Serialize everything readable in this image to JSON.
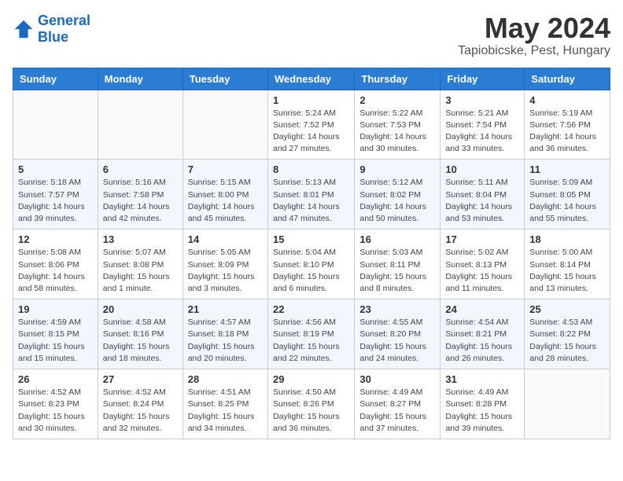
{
  "header": {
    "logo_line1": "General",
    "logo_line2": "Blue",
    "month": "May 2024",
    "location": "Tapiobicske, Pest, Hungary"
  },
  "weekdays": [
    "Sunday",
    "Monday",
    "Tuesday",
    "Wednesday",
    "Thursday",
    "Friday",
    "Saturday"
  ],
  "weeks": [
    [
      {
        "day": "",
        "info": ""
      },
      {
        "day": "",
        "info": ""
      },
      {
        "day": "",
        "info": ""
      },
      {
        "day": "1",
        "info": "Sunrise: 5:24 AM\nSunset: 7:52 PM\nDaylight: 14 hours\nand 27 minutes."
      },
      {
        "day": "2",
        "info": "Sunrise: 5:22 AM\nSunset: 7:53 PM\nDaylight: 14 hours\nand 30 minutes."
      },
      {
        "day": "3",
        "info": "Sunrise: 5:21 AM\nSunset: 7:54 PM\nDaylight: 14 hours\nand 33 minutes."
      },
      {
        "day": "4",
        "info": "Sunrise: 5:19 AM\nSunset: 7:56 PM\nDaylight: 14 hours\nand 36 minutes."
      }
    ],
    [
      {
        "day": "5",
        "info": "Sunrise: 5:18 AM\nSunset: 7:57 PM\nDaylight: 14 hours\nand 39 minutes."
      },
      {
        "day": "6",
        "info": "Sunrise: 5:16 AM\nSunset: 7:58 PM\nDaylight: 14 hours\nand 42 minutes."
      },
      {
        "day": "7",
        "info": "Sunrise: 5:15 AM\nSunset: 8:00 PM\nDaylight: 14 hours\nand 45 minutes."
      },
      {
        "day": "8",
        "info": "Sunrise: 5:13 AM\nSunset: 8:01 PM\nDaylight: 14 hours\nand 47 minutes."
      },
      {
        "day": "9",
        "info": "Sunrise: 5:12 AM\nSunset: 8:02 PM\nDaylight: 14 hours\nand 50 minutes."
      },
      {
        "day": "10",
        "info": "Sunrise: 5:11 AM\nSunset: 8:04 PM\nDaylight: 14 hours\nand 53 minutes."
      },
      {
        "day": "11",
        "info": "Sunrise: 5:09 AM\nSunset: 8:05 PM\nDaylight: 14 hours\nand 55 minutes."
      }
    ],
    [
      {
        "day": "12",
        "info": "Sunrise: 5:08 AM\nSunset: 8:06 PM\nDaylight: 14 hours\nand 58 minutes."
      },
      {
        "day": "13",
        "info": "Sunrise: 5:07 AM\nSunset: 8:08 PM\nDaylight: 15 hours\nand 1 minute."
      },
      {
        "day": "14",
        "info": "Sunrise: 5:05 AM\nSunset: 8:09 PM\nDaylight: 15 hours\nand 3 minutes."
      },
      {
        "day": "15",
        "info": "Sunrise: 5:04 AM\nSunset: 8:10 PM\nDaylight: 15 hours\nand 6 minutes."
      },
      {
        "day": "16",
        "info": "Sunrise: 5:03 AM\nSunset: 8:11 PM\nDaylight: 15 hours\nand 8 minutes."
      },
      {
        "day": "17",
        "info": "Sunrise: 5:02 AM\nSunset: 8:13 PM\nDaylight: 15 hours\nand 11 minutes."
      },
      {
        "day": "18",
        "info": "Sunrise: 5:00 AM\nSunset: 8:14 PM\nDaylight: 15 hours\nand 13 minutes."
      }
    ],
    [
      {
        "day": "19",
        "info": "Sunrise: 4:59 AM\nSunset: 8:15 PM\nDaylight: 15 hours\nand 15 minutes."
      },
      {
        "day": "20",
        "info": "Sunrise: 4:58 AM\nSunset: 8:16 PM\nDaylight: 15 hours\nand 18 minutes."
      },
      {
        "day": "21",
        "info": "Sunrise: 4:57 AM\nSunset: 8:18 PM\nDaylight: 15 hours\nand 20 minutes."
      },
      {
        "day": "22",
        "info": "Sunrise: 4:56 AM\nSunset: 8:19 PM\nDaylight: 15 hours\nand 22 minutes."
      },
      {
        "day": "23",
        "info": "Sunrise: 4:55 AM\nSunset: 8:20 PM\nDaylight: 15 hours\nand 24 minutes."
      },
      {
        "day": "24",
        "info": "Sunrise: 4:54 AM\nSunset: 8:21 PM\nDaylight: 15 hours\nand 26 minutes."
      },
      {
        "day": "25",
        "info": "Sunrise: 4:53 AM\nSunset: 8:22 PM\nDaylight: 15 hours\nand 28 minutes."
      }
    ],
    [
      {
        "day": "26",
        "info": "Sunrise: 4:52 AM\nSunset: 8:23 PM\nDaylight: 15 hours\nand 30 minutes."
      },
      {
        "day": "27",
        "info": "Sunrise: 4:52 AM\nSunset: 8:24 PM\nDaylight: 15 hours\nand 32 minutes."
      },
      {
        "day": "28",
        "info": "Sunrise: 4:51 AM\nSunset: 8:25 PM\nDaylight: 15 hours\nand 34 minutes."
      },
      {
        "day": "29",
        "info": "Sunrise: 4:50 AM\nSunset: 8:26 PM\nDaylight: 15 hours\nand 36 minutes."
      },
      {
        "day": "30",
        "info": "Sunrise: 4:49 AM\nSunset: 8:27 PM\nDaylight: 15 hours\nand 37 minutes."
      },
      {
        "day": "31",
        "info": "Sunrise: 4:49 AM\nSunset: 8:28 PM\nDaylight: 15 hours\nand 39 minutes."
      },
      {
        "day": "",
        "info": ""
      }
    ]
  ]
}
